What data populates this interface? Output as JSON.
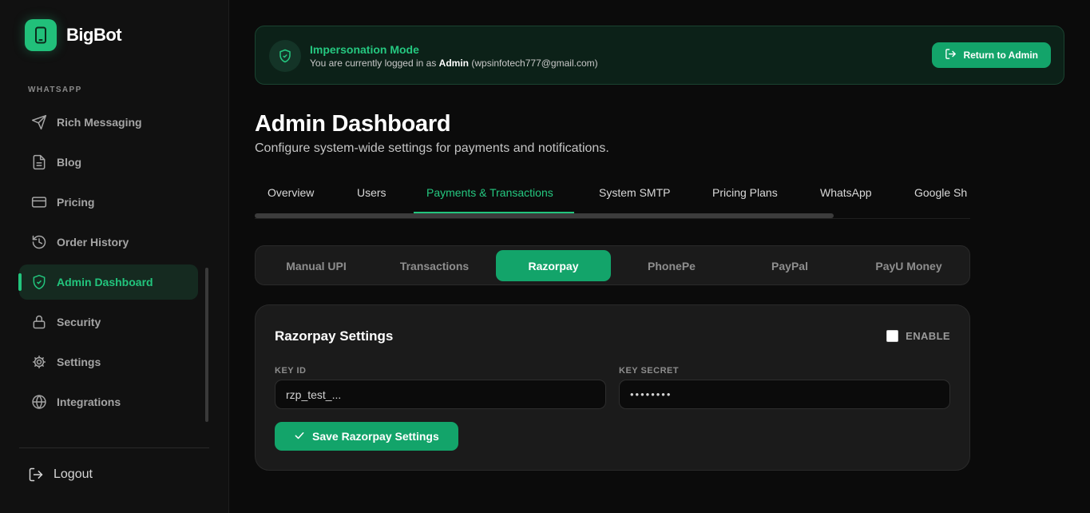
{
  "brand": {
    "name": "BigBot",
    "accent": "#22c57d"
  },
  "sidebar": {
    "section_label": "WHATSAPP",
    "items": [
      {
        "label": "Rich Messaging",
        "icon": "send-icon"
      },
      {
        "label": "Blog",
        "icon": "document-icon"
      },
      {
        "label": "Pricing",
        "icon": "credit-card-icon"
      },
      {
        "label": "Order History",
        "icon": "history-icon"
      },
      {
        "label": "Admin Dashboard",
        "icon": "shield-check-icon",
        "active": true
      },
      {
        "label": "Security",
        "icon": "lock-icon"
      },
      {
        "label": "Settings",
        "icon": "gear-icon"
      },
      {
        "label": "Integrations",
        "icon": "globe-icon"
      }
    ],
    "logout_label": "Logout"
  },
  "banner": {
    "title": "Impersonation Mode",
    "subtitle_prefix": "You are currently logged in as",
    "user_name": "Admin",
    "user_email": "(wpsinfotech777@gmail.com)",
    "return_label": "Return to Admin"
  },
  "header": {
    "title": "Admin Dashboard",
    "subtitle": "Configure system-wide settings for payments and notifications."
  },
  "tabs": [
    {
      "label": "Overview"
    },
    {
      "label": "Users"
    },
    {
      "label": "Payments & Transactions",
      "active": true
    },
    {
      "label": "System SMTP"
    },
    {
      "label": "Pricing Plans"
    },
    {
      "label": "WhatsApp"
    },
    {
      "label": "Google Sh"
    }
  ],
  "subtabs": [
    {
      "label": "Manual UPI"
    },
    {
      "label": "Transactions"
    },
    {
      "label": "Razorpay",
      "active": true
    },
    {
      "label": "PhonePe"
    },
    {
      "label": "PayPal"
    },
    {
      "label": "PayU Money"
    }
  ],
  "razorpay": {
    "title": "Razorpay Settings",
    "enable_label": "ENABLE",
    "enabled": false,
    "key_id_label": "KEY ID",
    "key_id_value": "rzp_test_...",
    "key_secret_label": "KEY SECRET",
    "key_secret_value": "••••••••",
    "save_label": "Save Razorpay Settings"
  }
}
